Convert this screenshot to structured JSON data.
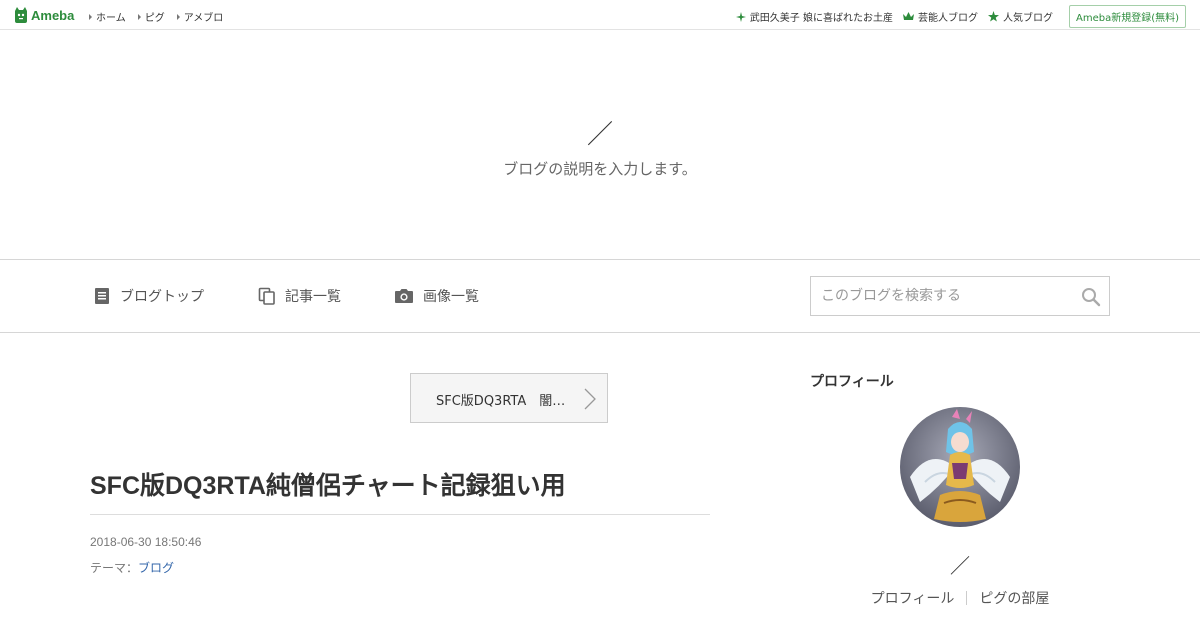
{
  "topbar": {
    "logo_text": "Ameba",
    "nav": [
      "ホーム",
      "ピグ",
      "アメブロ"
    ],
    "right_links": [
      {
        "icon": "sparkle-icon",
        "label": "武田久美子 娘に喜ばれたお土産"
      },
      {
        "icon": "crown-icon",
        "label": "芸能人ブログ"
      },
      {
        "icon": "star-icon",
        "label": "人気ブログ"
      }
    ],
    "signup_label": "Ameba新規登録(無料)",
    "accent_color": "#2d8c3c"
  },
  "header": {
    "blog_title": "／",
    "blog_description": "ブログの説明を入力します。"
  },
  "nav": {
    "items": [
      {
        "icon": "document-icon",
        "label": "ブログトップ"
      },
      {
        "icon": "copy-icon",
        "label": "記事一覧"
      },
      {
        "icon": "camera-icon",
        "label": "画像一覧"
      }
    ],
    "search_placeholder": "このブログを検索する"
  },
  "entry": {
    "next_label": "SFC版DQ3RTA　闇…",
    "title": "SFC版DQ3RTA純僧侶チャート記録狙い用",
    "date": "2018-06-30 18:50:46",
    "theme_prefix": "テーマ：",
    "theme": "ブログ"
  },
  "sidebar": {
    "heading": "プロフィール",
    "name": "／",
    "links": [
      "プロフィール",
      "ピグの部屋"
    ]
  }
}
